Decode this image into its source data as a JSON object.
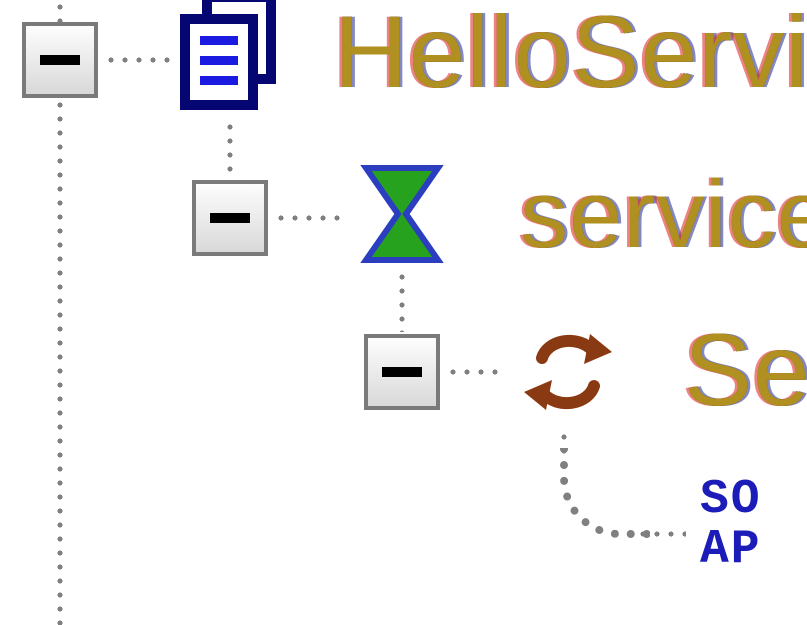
{
  "tree": {
    "node1": {
      "label": "HelloServi",
      "expanded": true,
      "icon": "documents-icon"
    },
    "node2": {
      "label": "service",
      "expanded": true,
      "icon": "interface-icon"
    },
    "node3": {
      "label": "Se",
      "expanded": true,
      "icon": "refresh-icon"
    },
    "leaf": {
      "line1": "SO",
      "line2": "AP"
    }
  }
}
